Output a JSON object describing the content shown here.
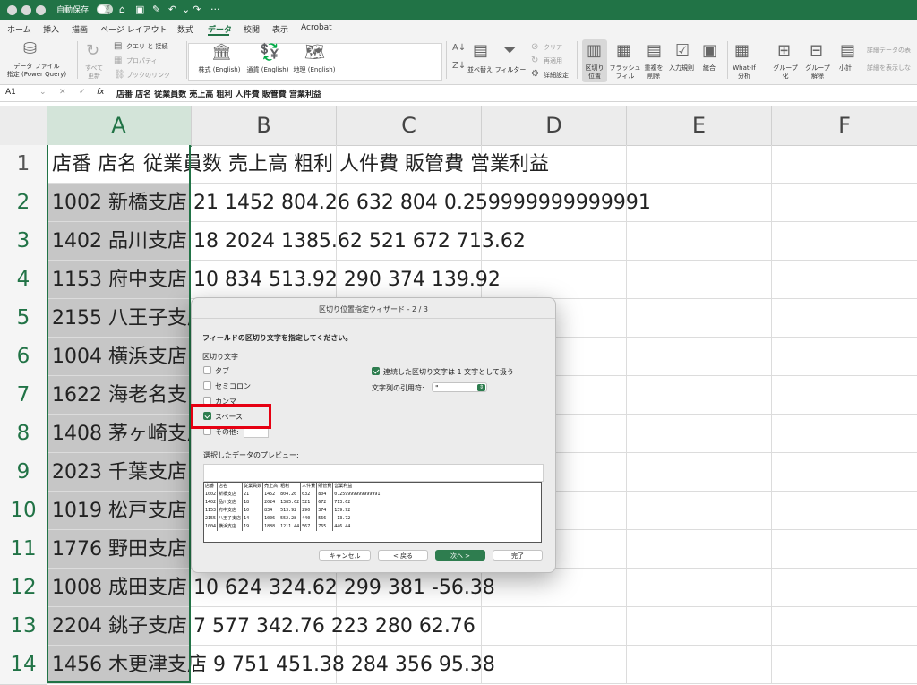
{
  "titlebar": {
    "autosave": "自動保存",
    "toggle_state": "オフ"
  },
  "menu": {
    "items": [
      "ホーム",
      "挿入",
      "描画",
      "ページ レイアウト",
      "数式",
      "データ",
      "校閲",
      "表示",
      "Acrobat"
    ]
  },
  "ribbon": {
    "get_data": "データ ファイル\n指定 (Power Query)",
    "refresh_all": "すべて\n更新",
    "queries": "クエリ と 接続",
    "properties": "プロパティ",
    "edit_links": "ブックのリンク",
    "dt_stocks": "株式 (English)",
    "dt_currency": "通貨 (English)",
    "dt_geo": "地理 (English)",
    "sort": "並べ替え",
    "filter": "フィルター",
    "clear": "クリア",
    "reapply": "再適用",
    "advanced": "詳細設定",
    "text_to_columns": "区切り\n位置",
    "flash_fill": "フラッシュ\nフィル",
    "remove_dup": "重複を\n削除",
    "validation": "入力規則",
    "consolidate": "統合",
    "whatif": "What-If\n分析",
    "group": "グループ\n化",
    "ungroup": "グループ\n解除",
    "subtotal": "小計",
    "show_detail": "詳細データの表",
    "hide_detail": "詳細を表示しな"
  },
  "formula_bar": {
    "name_box": "A1",
    "fx": "fx",
    "content": "店番 店名 従業員数 売上高 粗利 人件費 販管費 営業利益"
  },
  "columns": [
    "A",
    "B",
    "C",
    "D",
    "E",
    "F"
  ],
  "rows": [
    {
      "num": "1",
      "text": "店番 店名 従業員数 売上高 粗利 人件費 販管費 営業利益"
    },
    {
      "num": "2",
      "text": "1002 新橋支店 21 1452 804.26 632 804 0.259999999999991"
    },
    {
      "num": "3",
      "text": "1402 品川支店 18 2024 1385.62 521 672 713.62"
    },
    {
      "num": "4",
      "text": "1153 府中支店 10 834 513.92 290 374 139.92"
    },
    {
      "num": "5",
      "text": "2155 八王子支店 14 1006 552.28 440 566 -13.72"
    },
    {
      "num": "6",
      "text": "1004 横浜支店 19 1888 1211.44 567 765 446.44"
    },
    {
      "num": "7",
      "text": "1622 海老名支"
    },
    {
      "num": "8",
      "text": "1408 茅ヶ崎支店 12"
    },
    {
      "num": "9",
      "text": "2023 千葉支店"
    },
    {
      "num": "10",
      "text": "1019 松戸支店"
    },
    {
      "num": "11",
      "text": "1776 野田支店"
    },
    {
      "num": "12",
      "text": "1008 成田支店 10 624 324.62 299 381 -56.38"
    },
    {
      "num": "13",
      "text": "2204 銚子支店 7 577 342.76 223 280 62.76"
    },
    {
      "num": "14",
      "text": "1456 木更津支店 9 751 451.38 284 356 95.38"
    }
  ],
  "dialog": {
    "title": "区切り位置指定ウィザード - 2 / 3",
    "instruction": "フィールドの区切り文字を指定してください。",
    "delimiters_label": "区切り文字",
    "tab": "タブ",
    "semicolon": "セミコロン",
    "comma": "カンマ",
    "space": "スペース",
    "other": "その他:",
    "consecutive": "連続した区切り文字は 1 文字として扱う",
    "qualifier_label": "文字列の引用符:",
    "qualifier_value": "\"",
    "preview_label": "選択したデータのプレビュー:",
    "preview": [
      [
        "店番",
        "店名",
        "従業員数",
        "売上高",
        "粗利",
        "人件費",
        "販管費",
        "営業利益"
      ],
      [
        "1002",
        "新橋支店",
        "21",
        "1452",
        "804.26",
        "632",
        "804",
        "0.259999999999991"
      ],
      [
        "1402",
        "品川支店",
        "18",
        "2024",
        "1385.62",
        "521",
        "672",
        "713.62"
      ],
      [
        "1153",
        "府中支店",
        "10",
        "834",
        "513.92",
        "290",
        "374",
        "139.92"
      ],
      [
        "2155",
        "八王子支店",
        "14",
        "1006",
        "552.28",
        "440",
        "566",
        "-13.72"
      ],
      [
        "1004",
        "横浜支店",
        "19",
        "1888",
        "1211.44",
        "567",
        "765",
        "446.44"
      ]
    ],
    "cancel": "キャンセル",
    "back": "< 戻る",
    "next": "次へ >",
    "finish": "完了"
  }
}
